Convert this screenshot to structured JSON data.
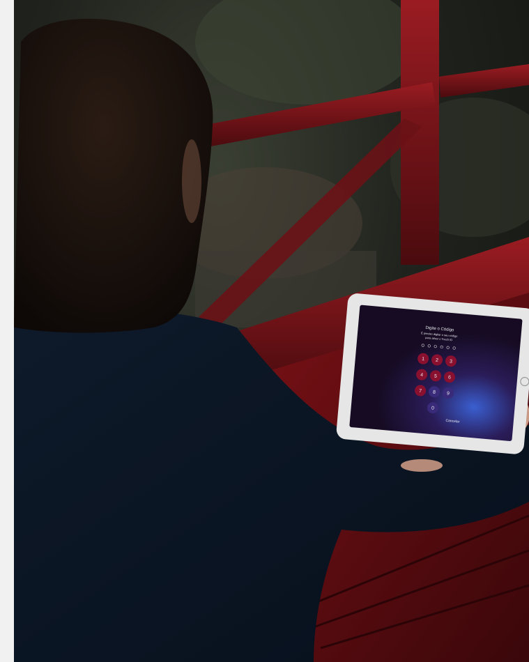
{
  "photo": {
    "description_colors": {
      "background": "#1c1e19",
      "railing": "#7a1418",
      "table": "#5a0d12",
      "jacket": "#0d1a2a",
      "hair": "#1a120e",
      "ipad_frame": "#e6e6e6",
      "screen": "#1a1030",
      "key": "#8a1030"
    },
    "ipad_screen": {
      "title": "Digite o Código",
      "subtitle_line1": "É preciso digitar o seu código",
      "subtitle_line2": "para ativar o Touch ID",
      "keys": [
        "1",
        "2",
        "3",
        "4",
        "5",
        "6",
        "7",
        "8",
        "9",
        "0"
      ],
      "cancel_label": "Cancelar"
    }
  }
}
